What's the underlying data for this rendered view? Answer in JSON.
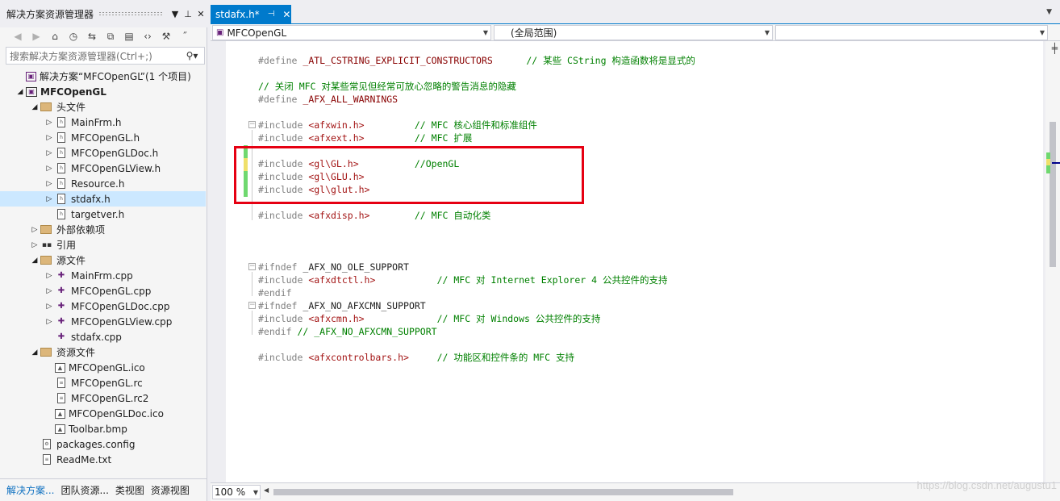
{
  "solution_explorer": {
    "title": "解决方案资源管理器",
    "search_placeholder": "搜索解决方案资源管理器(Ctrl+;)",
    "tree": [
      {
        "label": "解决方案“MFCOpenGL”(1 个项目)",
        "icon": "solution-icon",
        "level": 0,
        "expander": ""
      },
      {
        "label": "MFCOpenGL",
        "icon": "project-icon",
        "level": 0,
        "expander": "◢",
        "bold": true
      },
      {
        "label": "头文件",
        "icon": "folder-icon",
        "level": 1,
        "expander": "◢"
      },
      {
        "label": "MainFrm.h",
        "icon": "header-file-icon",
        "level": 2,
        "expander": "▷"
      },
      {
        "label": "MFCOpenGL.h",
        "icon": "header-file-icon",
        "level": 2,
        "expander": "▷"
      },
      {
        "label": "MFCOpenGLDoc.h",
        "icon": "header-file-icon",
        "level": 2,
        "expander": "▷"
      },
      {
        "label": "MFCOpenGLView.h",
        "icon": "header-file-icon",
        "level": 2,
        "expander": "▷"
      },
      {
        "label": "Resource.h",
        "icon": "header-file-icon",
        "level": 2,
        "expander": "▷"
      },
      {
        "label": "stdafx.h",
        "icon": "header-file-icon",
        "level": 2,
        "expander": "▷",
        "selected": true
      },
      {
        "label": "targetver.h",
        "icon": "header-file-icon",
        "level": 2,
        "expander": ""
      },
      {
        "label": "外部依赖项",
        "icon": "folder-icon",
        "level": 1,
        "expander": "▷"
      },
      {
        "label": "引用",
        "icon": "references-icon",
        "level": 1,
        "expander": "▷"
      },
      {
        "label": "源文件",
        "icon": "folder-icon",
        "level": 1,
        "expander": "◢"
      },
      {
        "label": "MainFrm.cpp",
        "icon": "cpp-file-icon",
        "level": 2,
        "expander": "▷"
      },
      {
        "label": "MFCOpenGL.cpp",
        "icon": "cpp-file-icon",
        "level": 2,
        "expander": "▷"
      },
      {
        "label": "MFCOpenGLDoc.cpp",
        "icon": "cpp-file-icon",
        "level": 2,
        "expander": "▷"
      },
      {
        "label": "MFCOpenGLView.cpp",
        "icon": "cpp-file-icon",
        "level": 2,
        "expander": "▷"
      },
      {
        "label": "stdafx.cpp",
        "icon": "cpp-file-icon",
        "level": 2,
        "expander": ""
      },
      {
        "label": "资源文件",
        "icon": "folder-icon",
        "level": 1,
        "expander": "◢"
      },
      {
        "label": "MFCOpenGL.ico",
        "icon": "image-file-icon",
        "level": 2,
        "expander": ""
      },
      {
        "label": "MFCOpenGL.rc",
        "icon": "resource-file-icon",
        "level": 2,
        "expander": ""
      },
      {
        "label": "MFCOpenGL.rc2",
        "icon": "resource-file-icon",
        "level": 2,
        "expander": ""
      },
      {
        "label": "MFCOpenGLDoc.ico",
        "icon": "image-file-icon",
        "level": 2,
        "expander": ""
      },
      {
        "label": "Toolbar.bmp",
        "icon": "image-file-icon",
        "level": 2,
        "expander": ""
      },
      {
        "label": "packages.config",
        "icon": "config-file-icon",
        "level": 1,
        "expander": ""
      },
      {
        "label": "ReadMe.txt",
        "icon": "text-file-icon",
        "level": 1,
        "expander": ""
      }
    ],
    "bottom_tabs": [
      "解决方案...",
      "团队资源...",
      "类视图",
      "资源视图"
    ]
  },
  "editor": {
    "tab_label": "stdafx.h*",
    "nav": {
      "project": "MFCOpenGL",
      "scope": "(全局范围)",
      "member": ""
    },
    "zoom": "100 %",
    "lines": [
      {
        "y": 0,
        "parts": [
          [
            "kw",
            "#define "
          ],
          [
            "id",
            "_ATL_CSTRING_EXPLICIT_CONSTRUCTORS"
          ],
          [
            "pl",
            "      "
          ],
          [
            "cm",
            "// 某些 CString 构造函数将是显式的"
          ]
        ]
      },
      {
        "y": 2,
        "parts": [
          [
            "cm",
            "// 关闭 MFC 对某些常见但经常可放心忽略的警告消息的隐藏"
          ]
        ]
      },
      {
        "y": 3,
        "parts": [
          [
            "kw",
            "#define "
          ],
          [
            "id",
            "_AFX_ALL_WARNINGS"
          ]
        ]
      },
      {
        "y": 5,
        "parts": [
          [
            "kw",
            "#include "
          ],
          [
            "inc",
            "<afxwin.h>"
          ],
          [
            "pl",
            "         "
          ],
          [
            "cm",
            "// MFC 核心组件和标准组件"
          ]
        ],
        "fold": true
      },
      {
        "y": 6,
        "parts": [
          [
            "kw",
            "#include "
          ],
          [
            "inc",
            "<afxext.h>"
          ],
          [
            "pl",
            "         "
          ],
          [
            "cm",
            "// MFC 扩展"
          ]
        ]
      },
      {
        "y": 8,
        "parts": [
          [
            "kw",
            "#include "
          ],
          [
            "inc",
            "<gl\\GL.h>"
          ],
          [
            "pl",
            "          "
          ],
          [
            "cm",
            "//OpenGL"
          ]
        ]
      },
      {
        "y": 9,
        "parts": [
          [
            "kw",
            "#include "
          ],
          [
            "inc",
            "<gl\\GLU.h>"
          ]
        ]
      },
      {
        "y": 10,
        "parts": [
          [
            "kw",
            "#include "
          ],
          [
            "inc",
            "<gl\\glut.h>"
          ]
        ]
      },
      {
        "y": 12,
        "parts": [
          [
            "kw",
            "#include "
          ],
          [
            "inc",
            "<afxdisp.h>"
          ],
          [
            "pl",
            "        "
          ],
          [
            "cm",
            "// MFC 自动化类"
          ]
        ]
      },
      {
        "y": 16,
        "parts": [
          [
            "kw",
            "#ifndef "
          ],
          [
            "pl",
            "_AFX_NO_OLE_SUPPORT"
          ]
        ],
        "fold": true
      },
      {
        "y": 17,
        "parts": [
          [
            "kw",
            "#include "
          ],
          [
            "inc",
            "<afxdtctl.h>"
          ],
          [
            "pl",
            "           "
          ],
          [
            "cm",
            "// MFC 对 Internet Explorer 4 公共控件的支持"
          ]
        ]
      },
      {
        "y": 18,
        "parts": [
          [
            "kw",
            "#endif"
          ]
        ]
      },
      {
        "y": 19,
        "parts": [
          [
            "kw",
            "#ifndef "
          ],
          [
            "pl",
            "_AFX_NO_AFXCMN_SUPPORT"
          ]
        ],
        "fold": true
      },
      {
        "y": 20,
        "parts": [
          [
            "kw",
            "#include "
          ],
          [
            "inc",
            "<afxcmn.h>"
          ],
          [
            "pl",
            "             "
          ],
          [
            "cm",
            "// MFC 对 Windows 公共控件的支持"
          ]
        ]
      },
      {
        "y": 21,
        "parts": [
          [
            "kw",
            "#endif "
          ],
          [
            "cm",
            "// _AFX_NO_AFXCMN_SUPPORT"
          ]
        ]
      },
      {
        "y": 23,
        "parts": [
          [
            "kw",
            "#include "
          ],
          [
            "inc",
            "<afxcontrolbars.h>"
          ],
          [
            "pl",
            "     "
          ],
          [
            "cm",
            "// 功能区和控件条的 MFC 支持"
          ]
        ]
      }
    ]
  },
  "watermark": "https://blog.csdn.net/augustu1"
}
